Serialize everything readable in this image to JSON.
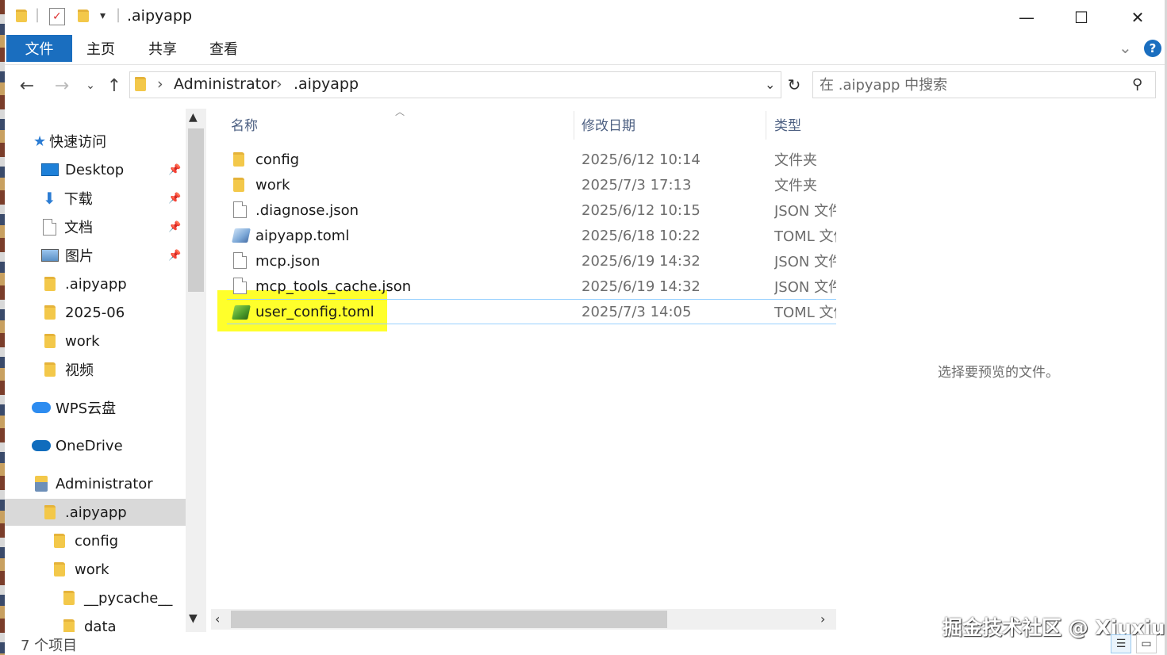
{
  "window": {
    "title": ".aipyapp",
    "minimize_glyph": "—",
    "maximize_glyph": "☐",
    "close_glyph": "✕"
  },
  "ribbon": {
    "tabs": [
      "文件",
      "主页",
      "共享",
      "查看"
    ],
    "help_glyph": "?",
    "expand_glyph": "⌄"
  },
  "address": {
    "segments": [
      "Administrator",
      ".aipyapp"
    ],
    "separator": "›"
  },
  "search": {
    "placeholder": "在 .aipyapp 中搜索"
  },
  "nav": {
    "items": [
      {
        "label": "快速访问",
        "icon": "star-icon"
      },
      {
        "label": "Desktop",
        "icon": "desktop-icon",
        "pinned": true
      },
      {
        "label": "下载",
        "icon": "download-icon",
        "pinned": true
      },
      {
        "label": "文档",
        "icon": "documents-icon",
        "pinned": true
      },
      {
        "label": "图片",
        "icon": "pictures-icon",
        "pinned": true
      },
      {
        "label": ".aipyapp",
        "icon": "folder-icon"
      },
      {
        "label": "2025-06",
        "icon": "folder-icon"
      },
      {
        "label": "work",
        "icon": "folder-icon"
      },
      {
        "label": "视频",
        "icon": "folder-icon"
      },
      {
        "label": "WPS云盘",
        "icon": "cloud-icon"
      },
      {
        "label": "OneDrive",
        "icon": "onedrive-icon"
      },
      {
        "label": "Administrator",
        "icon": "user-folder-icon"
      },
      {
        "label": ".aipyapp",
        "icon": "folder-icon",
        "selected": true
      },
      {
        "label": "config",
        "icon": "folder-icon"
      },
      {
        "label": "work",
        "icon": "folder-icon"
      },
      {
        "label": "__pycache__",
        "icon": "folder-icon"
      },
      {
        "label": "data",
        "icon": "folder-icon"
      }
    ]
  },
  "columns": {
    "name": "名称",
    "date": "修改日期",
    "type": "类型"
  },
  "files": [
    {
      "name": "config",
      "date": "2025/6/12 10:14",
      "type": "文件夹",
      "icon": "folder-icon"
    },
    {
      "name": "work",
      "date": "2025/7/3 17:13",
      "type": "文件夹",
      "icon": "folder-icon"
    },
    {
      "name": ".diagnose.json",
      "date": "2025/6/12 10:15",
      "type": "JSON 文件",
      "icon": "file-icon"
    },
    {
      "name": "aipyapp.toml",
      "date": "2025/6/18 10:22",
      "type": "TOML 文件",
      "icon": "toml-file-icon"
    },
    {
      "name": "mcp.json",
      "date": "2025/6/19 14:32",
      "type": "JSON 文件",
      "icon": "file-icon"
    },
    {
      "name": "mcp_tools_cache.json",
      "date": "2025/6/19 14:32",
      "type": "JSON 文件",
      "icon": "file-icon"
    },
    {
      "name": "user_config.toml",
      "date": "2025/7/3 14:05",
      "type": "TOML 文件",
      "icon": "toml-file-icon",
      "highlighted": true
    }
  ],
  "preview": {
    "empty_text": "选择要预览的文件。"
  },
  "status": {
    "count_text": "7 个项目"
  },
  "watermark": "掘金技术社区 @ Xiuxiu",
  "colors": {
    "accent": "#1a6ebf",
    "highlight": "#ffff2b",
    "folder": "#f3c84a"
  }
}
